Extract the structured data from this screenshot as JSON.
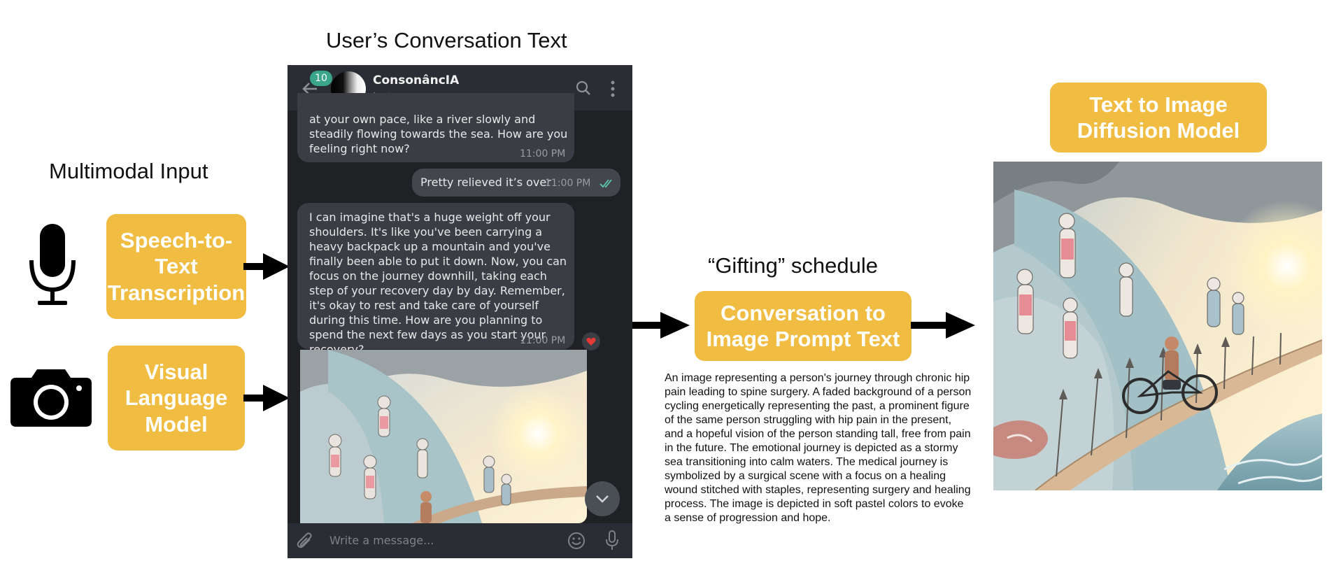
{
  "titles": {
    "conversation": "User’s Conversation Text",
    "multimodal": "Multimodal Input",
    "gifting": "“Gifting” schedule"
  },
  "boxes": {
    "speech": "Speech-to-Text Transcription",
    "visual": "Visual Language Model",
    "prompt": "Conversation to Image Prompt Text",
    "diffusion": "Text to Image Diffusion Model"
  },
  "chat": {
    "badge": "10",
    "bot_name": "ConsonâncIA",
    "bot_status": "bot",
    "msg1_text": "at your own pace, like a river slowly and steadily flowing towards the sea. How are you feeling right now?",
    "msg1_time": "11:00 PM",
    "msg2_text": "Pretty relieved it’s over",
    "msg2_time": "11:00 PM",
    "msg3_text": "I can imagine that's a huge weight off your shoulders. It's like you've been carrying a heavy backpack up a mountain and you've finally been able to put it down. Now, you can focus on the journey downhill, taking each step of your recovery day by day. Remember, it's okay to rest and take care of yourself during this time. How are you planning to spend the next few days as you start your recovery?",
    "msg3_time": "11:00 PM",
    "composer_placeholder": "Write a message..."
  },
  "prompt_text": "An image representing a person's journey through chronic hip pain leading to spine surgery. A faded background of a person cycling energetically representing the past, a prominent figure of the same person struggling with hip pain in the present, and a hopeful vision of the person standing tall, free from pain in the future. The emotional journey is depicted as a stormy sea transitioning into calm waters. The medical journey is symbolized by a surgical scene with a focus on a healing wound stitched with staples, representing surgery and healing process. The image is depicted in soft pastel colors to evoke a sense of progression and hope.",
  "colors": {
    "box_fill": "#F0BC42",
    "box_text": "#FFFFFF",
    "chat_bg": "#1F2125",
    "chat_header": "#2A2D33",
    "badge": "#3AA58A",
    "check": "#5CC8B0",
    "heart": "#E53935"
  },
  "icons": [
    "microphone-icon",
    "camera-icon",
    "back-arrow-icon",
    "search-icon",
    "menu-dots-icon",
    "double-check-icon",
    "heart-icon",
    "scroll-down-icon",
    "attach-icon",
    "emoji-icon",
    "composer-mic-icon"
  ]
}
